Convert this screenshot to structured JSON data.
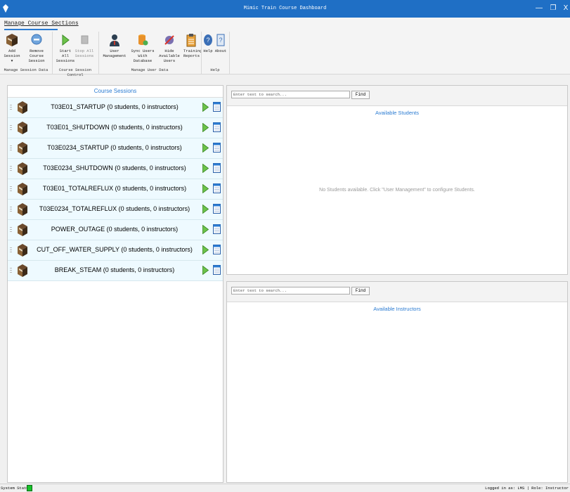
{
  "window": {
    "title": "Mimic Train Course Dashboard",
    "minimize": "—",
    "restore": "❐",
    "close": "X"
  },
  "ribbon": {
    "tab": "Manage Course Sections",
    "buttons": {
      "add_session": "Add Session",
      "add_session_arrow": "▾",
      "remove_session_1": "Remove Course",
      "remove_session_2": "Session",
      "start_all_1": "Start All",
      "start_all_2": "Sessions",
      "stop_all_1": "Stop All",
      "stop_all_2": "Sessions",
      "user_management": "User Management",
      "sync_users_1": "Sync Users",
      "sync_users_2": "With Database",
      "hide_users_1": "Hide Available",
      "hide_users_2": "Users",
      "training_reports_1": "Training",
      "training_reports_2": "Reports",
      "help": "Help",
      "about": "About"
    },
    "groups": {
      "session_data": "Manage Session Data",
      "session_control": "Course Session Control",
      "user_data": "Manage User Data",
      "help": "Help"
    }
  },
  "sessions": {
    "header": "Course Sessions",
    "items": [
      "T03E01_STARTUP (0 students, 0 instructors)",
      "T03E01_SHUTDOWN (0 students, 0 instructors)",
      "T03E0234_STARTUP (0 students, 0 instructors)",
      "T03E0234_SHUTDOWN (0 students, 0 instructors)",
      "T03E01_TOTALREFLUX (0 students, 0 instructors)",
      "T03E0234_TOTALREFLUX (0 students, 0 instructors)",
      "POWER_OUTAGE (0 students, 0 instructors)",
      "CUT_OFF_WATER_SUPPLY (0 students, 0 instructors)",
      "BREAK_STEAM (0 students, 0 instructors)"
    ]
  },
  "students": {
    "search_placeholder": "Enter text to search...",
    "find": "Find",
    "title": "Available Students",
    "empty": "No Students available. Click \"User Management\" to configure Students."
  },
  "instructors": {
    "search_placeholder": "Enter text to search...",
    "find": "Find",
    "title": "Available Instructors"
  },
  "status": {
    "label": "System Status:",
    "status_color": "#17c22a",
    "login": "Logged in as: LMS | Role: Instructor"
  },
  "colors": {
    "accent": "#2a7bd2",
    "titlebar": "#1f6fc5",
    "row_bg": "#eefaff"
  }
}
